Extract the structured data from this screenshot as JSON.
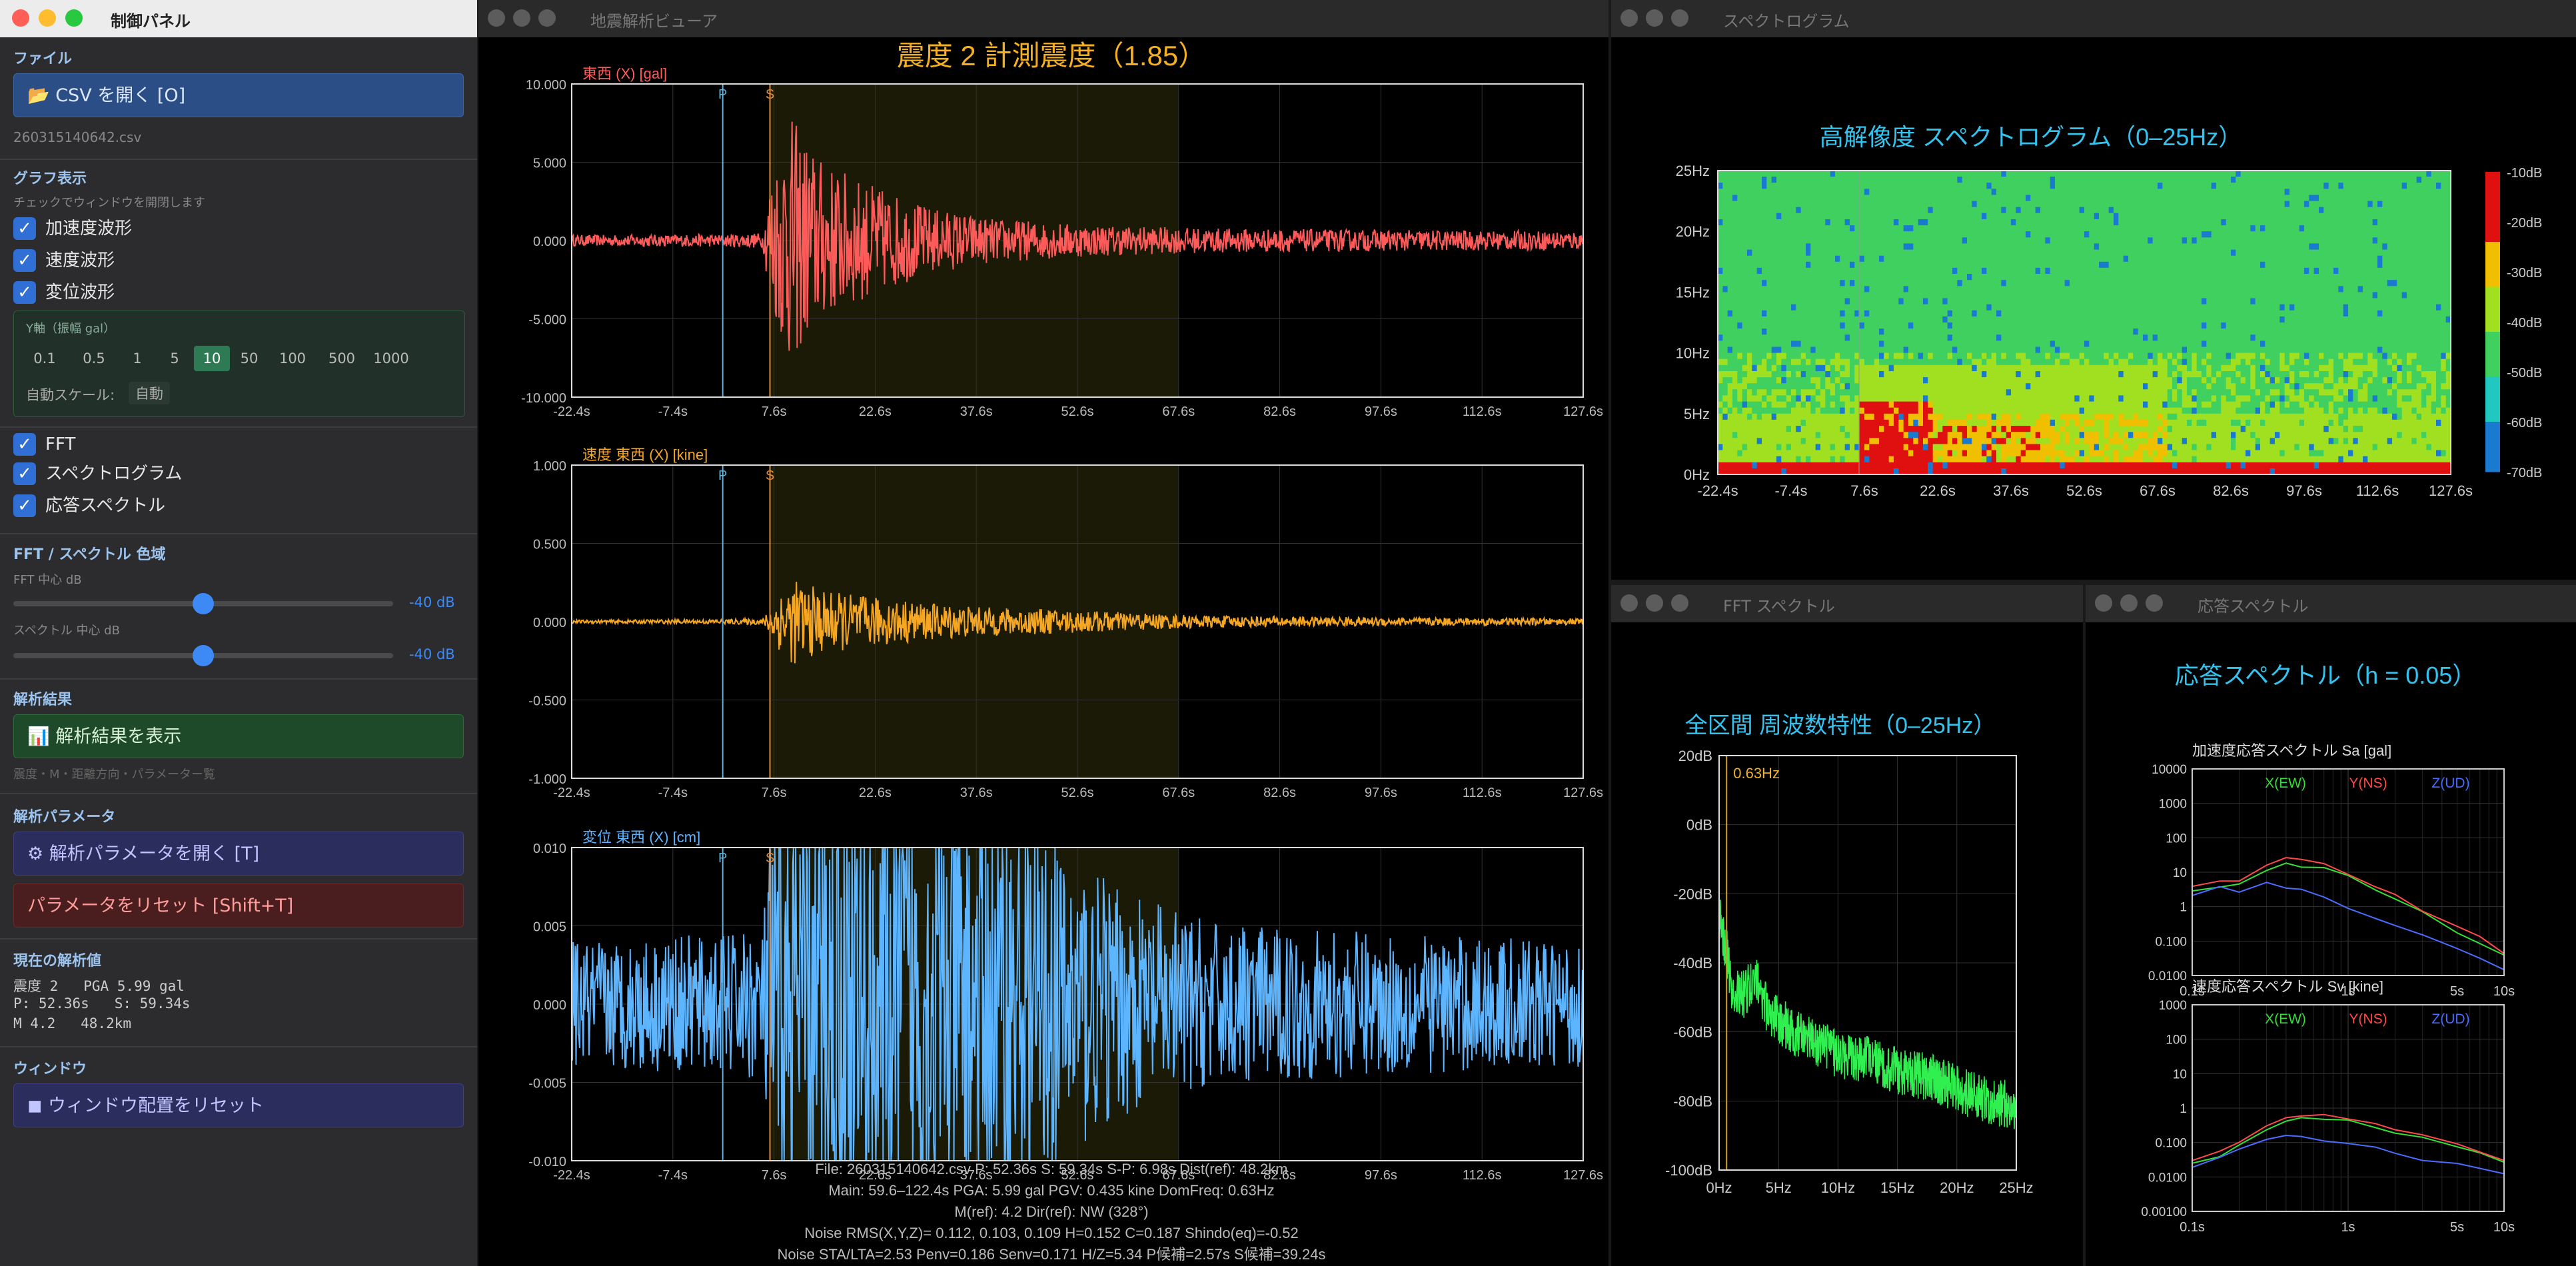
{
  "control": {
    "title": "制御パネル",
    "file_section": "ファイル",
    "open_csv_button": "📂 CSV を開く [O]",
    "filename": "260315140642.csv",
    "graph_section": "グラフ表示",
    "graph_hint": "チェックでウィンドウを開閉します",
    "checkboxes_top": [
      "加速度波形",
      "速度波形",
      "変位波形"
    ],
    "yaxis_label": "Y軸（振幅 gal）",
    "yaxis_options": [
      "0.1",
      "0.5",
      "1",
      "5",
      "10",
      "50",
      "100",
      "500",
      "1000"
    ],
    "yaxis_selected": "10",
    "autoscale_label": "自動スケール:",
    "autoscale_value": "自動",
    "checkboxes_bottom": [
      "FFT",
      "スペクトログラム",
      "応答スペクトル"
    ],
    "fft_color_section": "FFT / スペクトル 色域",
    "fft_center_label": "FFT 中心 dB",
    "fft_center_value": "-40 dB",
    "fft_center_fraction": 0.5,
    "spec_center_label": "スペクトル 中心 dB",
    "spec_center_value": "-40 dB",
    "spec_center_fraction": 0.5,
    "result_section": "解析結果",
    "show_result_button": "📊 解析結果を表示",
    "result_hint": "震度・M・距離方向・パラメーター覧",
    "param_section": "解析パラメータ",
    "open_param_button": "⚙ 解析パラメータを開く [T]",
    "reset_param_button": "パラメータをリセット [Shift+T]",
    "current_section": "現在の解析値",
    "current_lines": [
      "震度 2   PGA 5.99 gal",
      "P: 52.36s   S: 59.34s",
      "M 4.2   48.2km"
    ],
    "window_section": "ウィンドウ",
    "reset_window_button": "◼ ウィンドウ配置をリセット"
  },
  "viewer": {
    "title": "地震解析ビューア",
    "heading": "震度 2  計測震度（1.85）",
    "xticks": [
      "-22.4s",
      "-7.4s",
      "7.6s",
      "22.6s",
      "37.6s",
      "52.6s",
      "67.6s",
      "82.6s",
      "97.6s",
      "112.6s",
      "127.6s"
    ],
    "p_label": "P",
    "s_label": "S",
    "info_lines": [
      "File: 260315140642.csv   P: 52.36s   S: 59.34s   S-P: 6.98s   Dist(ref): 48.2km",
      "Main: 59.6–122.4s   PGA: 5.99 gal   PGV: 0.435 kine   DomFreq: 0.63Hz",
      "M(ref): 4.2   Dir(ref): NW (328°)",
      "Noise RMS(X,Y,Z)= 0.112, 0.103, 0.109   H=0.152   C=0.187   Shindo(eq)=-0.52",
      "Noise STA/LTA=2.53   Penv=0.186   Senv=0.171   H/Z=5.34   P候補=2.57s   S候補=39.24s"
    ]
  },
  "spectrogram": {
    "title": "スペクトログラム",
    "heading": "高解像度 スペクトログラム（0–25Hz）",
    "yticks": [
      "25Hz",
      "20Hz",
      "15Hz",
      "10Hz",
      "5Hz",
      "0Hz"
    ],
    "xticks": [
      "-22.4s",
      "-7.4s",
      "7.6s",
      "22.6s",
      "37.6s",
      "52.6s",
      "67.6s",
      "82.6s",
      "97.6s",
      "112.6s",
      "127.6s"
    ],
    "colorbar_ticks": [
      "-10dB",
      "-20dB",
      "-30dB",
      "-40dB",
      "-50dB",
      "-60dB",
      "-70dB"
    ]
  },
  "fft": {
    "title": "FFT スペクトル",
    "heading": "全区間 周波数特性（0–25Hz）",
    "peak_label": "0.63Hz",
    "yticks": [
      "20dB",
      "0dB",
      "-20dB",
      "-40dB",
      "-60dB",
      "-80dB",
      "-100dB"
    ],
    "xticks": [
      "0Hz",
      "5Hz",
      "10Hz",
      "15Hz",
      "20Hz",
      "25Hz"
    ]
  },
  "response": {
    "title": "応答スペクトル",
    "heading": "応答スペクトル（h = 0.05）",
    "legend": [
      "X(EW)",
      "Y(NS)",
      "Z(UD)"
    ],
    "xticks": [
      "0.1s",
      "1s",
      "5s",
      "10s"
    ]
  },
  "chart_data": [
    {
      "type": "line",
      "title": "東西 (X) [gal]",
      "color": "#ff5a5a",
      "xlim": [
        -22.4,
        127.6
      ],
      "ylim": [
        -10,
        10
      ],
      "yticks": [
        "10.000",
        "5.000",
        "0.000",
        "-5.000",
        "-10.000"
      ],
      "p_time": 0,
      "s_time": 7,
      "envelope": [
        [
          -22.4,
          0.35
        ],
        [
          0,
          0.4
        ],
        [
          6,
          0.5
        ],
        [
          7,
          4.2
        ],
        [
          10,
          8.0
        ],
        [
          15,
          5.0
        ],
        [
          22,
          3.6
        ],
        [
          30,
          2.2
        ],
        [
          40,
          1.4
        ],
        [
          55,
          1.0
        ],
        [
          70,
          0.8
        ],
        [
          90,
          0.7
        ],
        [
          127.6,
          0.6
        ]
      ]
    },
    {
      "type": "line",
      "title": "速度 東西 (X) [kine]",
      "color": "#f5a623",
      "xlim": [
        -22.4,
        127.6
      ],
      "ylim": [
        -1,
        1
      ],
      "yticks": [
        "1.000",
        "0.500",
        "0.000",
        "-0.500",
        "-1.000"
      ],
      "p_time": 0,
      "s_time": 7,
      "envelope": [
        [
          -22.4,
          0.01
        ],
        [
          0,
          0.015
        ],
        [
          6,
          0.02
        ],
        [
          7,
          0.1
        ],
        [
          10,
          0.28
        ],
        [
          15,
          0.2
        ],
        [
          22,
          0.16
        ],
        [
          30,
          0.12
        ],
        [
          40,
          0.09
        ],
        [
          55,
          0.07
        ],
        [
          70,
          0.04
        ],
        [
          90,
          0.03
        ],
        [
          127.6,
          0.02
        ]
      ]
    },
    {
      "type": "line",
      "title": "変位 東西 (X) [cm]",
      "color": "#5db4ff",
      "xlim": [
        -22.4,
        127.6
      ],
      "ylim": [
        -0.01,
        0.01
      ],
      "yticks": [
        "0.010",
        "0.005",
        "0.000",
        "-0.005",
        "-0.010"
      ],
      "p_time": 0,
      "s_time": 7,
      "envelope": [
        [
          -22.4,
          0.004
        ],
        [
          0,
          0.0045
        ],
        [
          6,
          0.005
        ],
        [
          7,
          0.012
        ],
        [
          15,
          0.015
        ],
        [
          30,
          0.014
        ],
        [
          45,
          0.012
        ],
        [
          60,
          0.007
        ],
        [
          75,
          0.005
        ],
        [
          127.6,
          0.004
        ]
      ]
    },
    {
      "type": "heatmap",
      "title": "高解像度 スペクトログラム（0–25Hz）",
      "xlim": [
        -22.4,
        127.6
      ],
      "ylim": [
        0,
        25
      ],
      "zlim": [
        -70,
        -10
      ]
    },
    {
      "type": "line",
      "title": "全区間 周波数特性（0–25Hz）",
      "xlim": [
        0,
        25
      ],
      "ylim": [
        -100,
        20
      ],
      "x": [
        0,
        0.63,
        1,
        2,
        3,
        4,
        5,
        6,
        8,
        10,
        12,
        15,
        18,
        20,
        22,
        25
      ],
      "y": [
        -25,
        -35,
        -45,
        -48,
        -43,
        -52,
        -55,
        -58,
        -62,
        -65,
        -66,
        -70,
        -72,
        -75,
        -78,
        -80
      ]
    },
    {
      "type": "line",
      "title": "加速度応答スペクトル Sa [gal]",
      "xlim": [
        0.1,
        10
      ],
      "ylim": [
        0.01,
        10000
      ],
      "yticks": [
        "10000",
        "1000",
        "100",
        "10",
        "1",
        "0.100",
        "0.0100"
      ],
      "x": [
        0.1,
        0.15,
        0.2,
        0.3,
        0.4,
        0.5,
        0.7,
        1,
        1.5,
        2,
        3,
        5,
        7,
        10
      ],
      "series": [
        {
          "name": "X(EW)",
          "color": "#35e035",
          "values": [
            3,
            4,
            5,
            10,
            18,
            15,
            13,
            8,
            3,
            1.5,
            0.7,
            0.2,
            0.09,
            0.04
          ]
        },
        {
          "name": "Y(NS)",
          "color": "#ff4a4a",
          "values": [
            3.5,
            5,
            6,
            15,
            25,
            22,
            17,
            10,
            4,
            2,
            0.8,
            0.3,
            0.12,
            0.05
          ]
        },
        {
          "name": "Z(UD)",
          "color": "#4a6cff",
          "values": [
            2,
            4,
            3,
            5,
            4,
            3,
            2,
            1,
            0.5,
            0.3,
            0.15,
            0.06,
            0.03,
            0.015
          ]
        }
      ]
    },
    {
      "type": "line",
      "title": "速度応答スペクトル Sv [kine]",
      "xlim": [
        0.1,
        10
      ],
      "ylim": [
        0.001,
        10000
      ],
      "yticks": [
        "1000",
        "100",
        "10",
        "1",
        "0.100",
        "0.0100",
        "0.00100"
      ],
      "x": [
        0.1,
        0.15,
        0.2,
        0.3,
        0.4,
        0.5,
        0.7,
        1,
        1.5,
        2,
        3,
        5,
        7,
        10
      ],
      "series": [
        {
          "name": "X(EW)",
          "color": "#35e035",
          "values": [
            0.05,
            0.08,
            0.2,
            0.6,
            1.2,
            1.5,
            1.3,
            1.2,
            0.8,
            0.5,
            0.3,
            0.15,
            0.09,
            0.05
          ]
        },
        {
          "name": "Y(NS)",
          "color": "#ff4a4a",
          "values": [
            0.06,
            0.1,
            0.25,
            0.8,
            1.6,
            2.0,
            1.7,
            1.5,
            1.0,
            0.6,
            0.35,
            0.18,
            0.1,
            0.06
          ]
        },
        {
          "name": "Z(UD)",
          "color": "#4a6cff",
          "values": [
            0.03,
            0.06,
            0.15,
            0.3,
            0.35,
            0.3,
            0.25,
            0.2,
            0.15,
            0.1,
            0.06,
            0.04,
            0.03,
            0.02
          ]
        }
      ]
    }
  ]
}
